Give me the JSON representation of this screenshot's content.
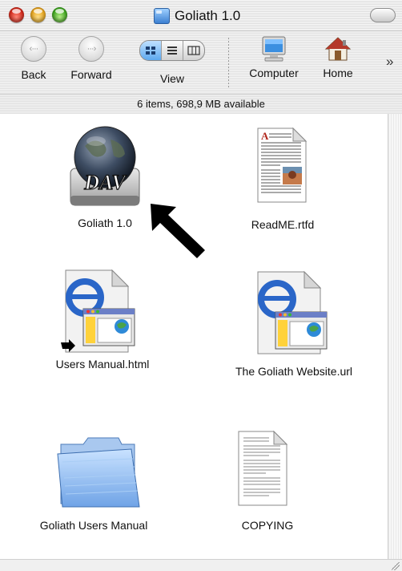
{
  "window": {
    "title": "Goliath 1.0"
  },
  "toolbar": {
    "back_label": "Back",
    "back_glyph": "‹···",
    "forward_label": "Forward",
    "forward_glyph": "···›",
    "view_label": "View",
    "computer_label": "Computer",
    "home_label": "Home",
    "overflow_glyph": "»"
  },
  "status": {
    "text": "6 items, 698,9 MB available"
  },
  "files": [
    {
      "label": "Goliath 1.0",
      "icon": "dav-disk-icon"
    },
    {
      "label": "ReadME.rtfd",
      "icon": "rtfd-document-icon"
    },
    {
      "label": "Users Manual.html",
      "icon": "html-document-alias-icon"
    },
    {
      "label": "The Goliath Website.url",
      "icon": "url-document-icon"
    },
    {
      "label": "Goliath Users Manual",
      "icon": "folder-icon"
    },
    {
      "label": "COPYING",
      "icon": "text-document-icon"
    }
  ],
  "colors": {
    "folder_blue": "#7fb1ea",
    "selection_blue": "#5da8ef",
    "ie_blue": "#2a66c8"
  }
}
